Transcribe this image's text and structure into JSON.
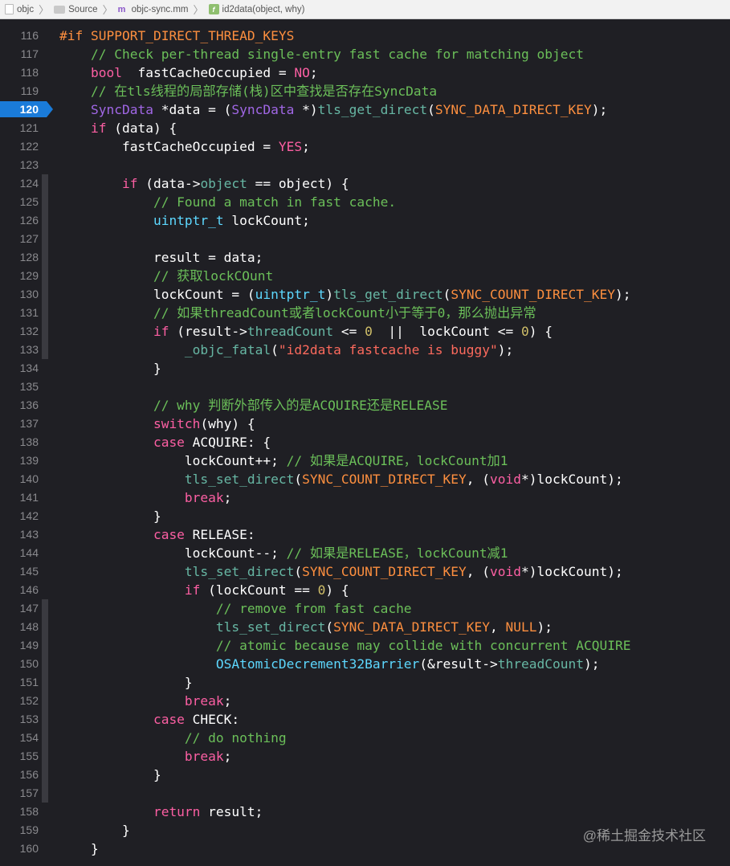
{
  "jumpbar": {
    "items": [
      "objc",
      "Source",
      "objc-sync.mm",
      "id2data(object, why)"
    ]
  },
  "colors": {
    "background": "#1f1f24",
    "keyword": "#fc5fa3",
    "preprocessor": "#fd8f3f",
    "comment": "#6bbf59",
    "type": "#5dd8ff",
    "breakpoint": "#1a7bd9"
  },
  "editor": {
    "breakpoint_line": 120,
    "lines": [
      {
        "n": "116",
        "t": [
          [
            "pp",
            "#if SUPPORT_DIRECT_THREAD_KEYS"
          ]
        ]
      },
      {
        "n": "117",
        "t": [
          [
            "cm",
            "    // Check per-thread single-entry fast cache for matching object"
          ]
        ]
      },
      {
        "n": "118",
        "t": [
          [
            "kw",
            "    bool"
          ],
          [
            "",
            "  fastCacheOccupied = "
          ],
          [
            "kw",
            "NO"
          ],
          [
            "",
            ";"
          ]
        ]
      },
      {
        "n": "119",
        "t": [
          [
            "cm",
            "    // 在tls线程的局部存储(栈)区中查找是否存在SyncData"
          ]
        ]
      },
      {
        "n": "120",
        "t": [
          [
            "ac",
            "    SyncData"
          ],
          [
            "",
            " *data = ("
          ],
          [
            "ac",
            "SyncData"
          ],
          [
            "",
            " *)"
          ],
          [
            "fn",
            "tls_get_direct"
          ],
          [
            "",
            "("
          ],
          [
            "mc",
            "SYNC_DATA_DIRECT_KEY"
          ],
          [
            "",
            ");"
          ]
        ]
      },
      {
        "n": "121",
        "t": [
          [
            "kw",
            "    if"
          ],
          [
            "",
            " (data) {"
          ]
        ]
      },
      {
        "n": "122",
        "t": [
          [
            "",
            "        fastCacheOccupied = "
          ],
          [
            "kw",
            "YES"
          ],
          [
            "",
            ";"
          ]
        ]
      },
      {
        "n": "123",
        "t": []
      },
      {
        "n": "124",
        "t": [
          [
            "kw",
            "        if"
          ],
          [
            "",
            " (data->"
          ],
          [
            "fn",
            "object"
          ],
          [
            "",
            " == object) {"
          ]
        ]
      },
      {
        "n": "125",
        "t": [
          [
            "cm",
            "            // Found a match in fast cache."
          ]
        ]
      },
      {
        "n": "126",
        "t": [
          [
            "ty",
            "            uintptr_t"
          ],
          [
            "",
            " lockCount;"
          ]
        ]
      },
      {
        "n": "127",
        "t": []
      },
      {
        "n": "128",
        "t": [
          [
            "",
            "            result = data;"
          ]
        ]
      },
      {
        "n": "129",
        "t": [
          [
            "cm",
            "            // 获取lockCOunt"
          ]
        ]
      },
      {
        "n": "130",
        "t": [
          [
            "",
            "            lockCount = ("
          ],
          [
            "ty",
            "uintptr_t"
          ],
          [
            "",
            ")"
          ],
          [
            "fn",
            "tls_get_direct"
          ],
          [
            "",
            "("
          ],
          [
            "mc",
            "SYNC_COUNT_DIRECT_KEY"
          ],
          [
            "",
            ");"
          ]
        ]
      },
      {
        "n": "131",
        "t": [
          [
            "cm",
            "            // 如果threadCount或者lockCount小于等于0，那么抛出异常"
          ]
        ]
      },
      {
        "n": "132",
        "t": [
          [
            "kw",
            "            if"
          ],
          [
            "",
            " (result->"
          ],
          [
            "fn",
            "threadCount"
          ],
          [
            "",
            " <= "
          ],
          [
            "nm",
            "0"
          ],
          [
            "",
            "  ||  lockCount <= "
          ],
          [
            "nm",
            "0"
          ],
          [
            "",
            ") {"
          ]
        ]
      },
      {
        "n": "133",
        "t": [
          [
            "fn",
            "                _objc_fatal"
          ],
          [
            "",
            "("
          ],
          [
            "st",
            "\"id2data fastcache is buggy\""
          ],
          [
            "",
            ");"
          ]
        ]
      },
      {
        "n": "134",
        "t": [
          [
            "",
            "            }"
          ]
        ]
      },
      {
        "n": "135",
        "t": []
      },
      {
        "n": "136",
        "t": [
          [
            "cm",
            "            // why 判断外部传入的是ACQUIRE还是RELEASE"
          ]
        ]
      },
      {
        "n": "137",
        "t": [
          [
            "kw",
            "            switch"
          ],
          [
            "",
            "(why) {"
          ]
        ]
      },
      {
        "n": "138",
        "t": [
          [
            "kw",
            "            case"
          ],
          [
            "",
            " ACQUIRE: {"
          ]
        ]
      },
      {
        "n": "139",
        "t": [
          [
            "",
            "                lockCount++; "
          ],
          [
            "cm",
            "// 如果是ACQUIRE，lockCount加1"
          ]
        ]
      },
      {
        "n": "140",
        "t": [
          [
            "fn",
            "                tls_set_direct"
          ],
          [
            "",
            "("
          ],
          [
            "mc",
            "SYNC_COUNT_DIRECT_KEY"
          ],
          [
            "",
            ", ("
          ],
          [
            "kw",
            "void"
          ],
          [
            "",
            "*)lockCount);"
          ]
        ]
      },
      {
        "n": "141",
        "t": [
          [
            "kw",
            "                break"
          ],
          [
            "",
            ";"
          ]
        ]
      },
      {
        "n": "142",
        "t": [
          [
            "",
            "            }"
          ]
        ]
      },
      {
        "n": "143",
        "t": [
          [
            "kw",
            "            case"
          ],
          [
            "",
            " RELEASE:"
          ]
        ]
      },
      {
        "n": "144",
        "t": [
          [
            "",
            "                lockCount--; "
          ],
          [
            "cm",
            "// 如果是RELEASE，lockCount减1"
          ]
        ]
      },
      {
        "n": "145",
        "t": [
          [
            "fn",
            "                tls_set_direct"
          ],
          [
            "",
            "("
          ],
          [
            "mc",
            "SYNC_COUNT_DIRECT_KEY"
          ],
          [
            "",
            ", ("
          ],
          [
            "kw",
            "void"
          ],
          [
            "",
            "*)lockCount);"
          ]
        ]
      },
      {
        "n": "146",
        "t": [
          [
            "kw",
            "                if"
          ],
          [
            "",
            " (lockCount == "
          ],
          [
            "nm",
            "0"
          ],
          [
            "",
            ") {"
          ]
        ]
      },
      {
        "n": "147",
        "t": [
          [
            "cm",
            "                    // remove from fast cache"
          ]
        ]
      },
      {
        "n": "148",
        "t": [
          [
            "fn",
            "                    tls_set_direct"
          ],
          [
            "",
            "("
          ],
          [
            "mc",
            "SYNC_DATA_DIRECT_KEY"
          ],
          [
            "",
            ", "
          ],
          [
            "mc",
            "NULL"
          ],
          [
            "",
            ");"
          ]
        ]
      },
      {
        "n": "149",
        "t": [
          [
            "cm",
            "                    // atomic because may collide with concurrent ACQUIRE"
          ]
        ]
      },
      {
        "n": "150",
        "t": [
          [
            "ty",
            "                    OSAtomicDecrement32Barrier"
          ],
          [
            "",
            "(&result->"
          ],
          [
            "fn",
            "threadCount"
          ],
          [
            "",
            ");"
          ]
        ]
      },
      {
        "n": "151",
        "t": [
          [
            "",
            "                }"
          ]
        ]
      },
      {
        "n": "152",
        "t": [
          [
            "kw",
            "                break"
          ],
          [
            "",
            ";"
          ]
        ]
      },
      {
        "n": "153",
        "t": [
          [
            "kw",
            "            case"
          ],
          [
            "",
            " CHECK:"
          ]
        ]
      },
      {
        "n": "154",
        "t": [
          [
            "cm",
            "                // do nothing"
          ]
        ]
      },
      {
        "n": "155",
        "t": [
          [
            "kw",
            "                break"
          ],
          [
            "",
            ";"
          ]
        ]
      },
      {
        "n": "156",
        "t": [
          [
            "",
            "            }"
          ]
        ]
      },
      {
        "n": "157",
        "t": []
      },
      {
        "n": "158",
        "t": [
          [
            "kw",
            "            return"
          ],
          [
            "",
            " result;"
          ]
        ]
      },
      {
        "n": "159",
        "t": [
          [
            "",
            "        }"
          ]
        ]
      },
      {
        "n": "160",
        "t": [
          [
            "",
            "    }"
          ]
        ]
      }
    ]
  },
  "watermark": "@稀土掘金技术社区"
}
